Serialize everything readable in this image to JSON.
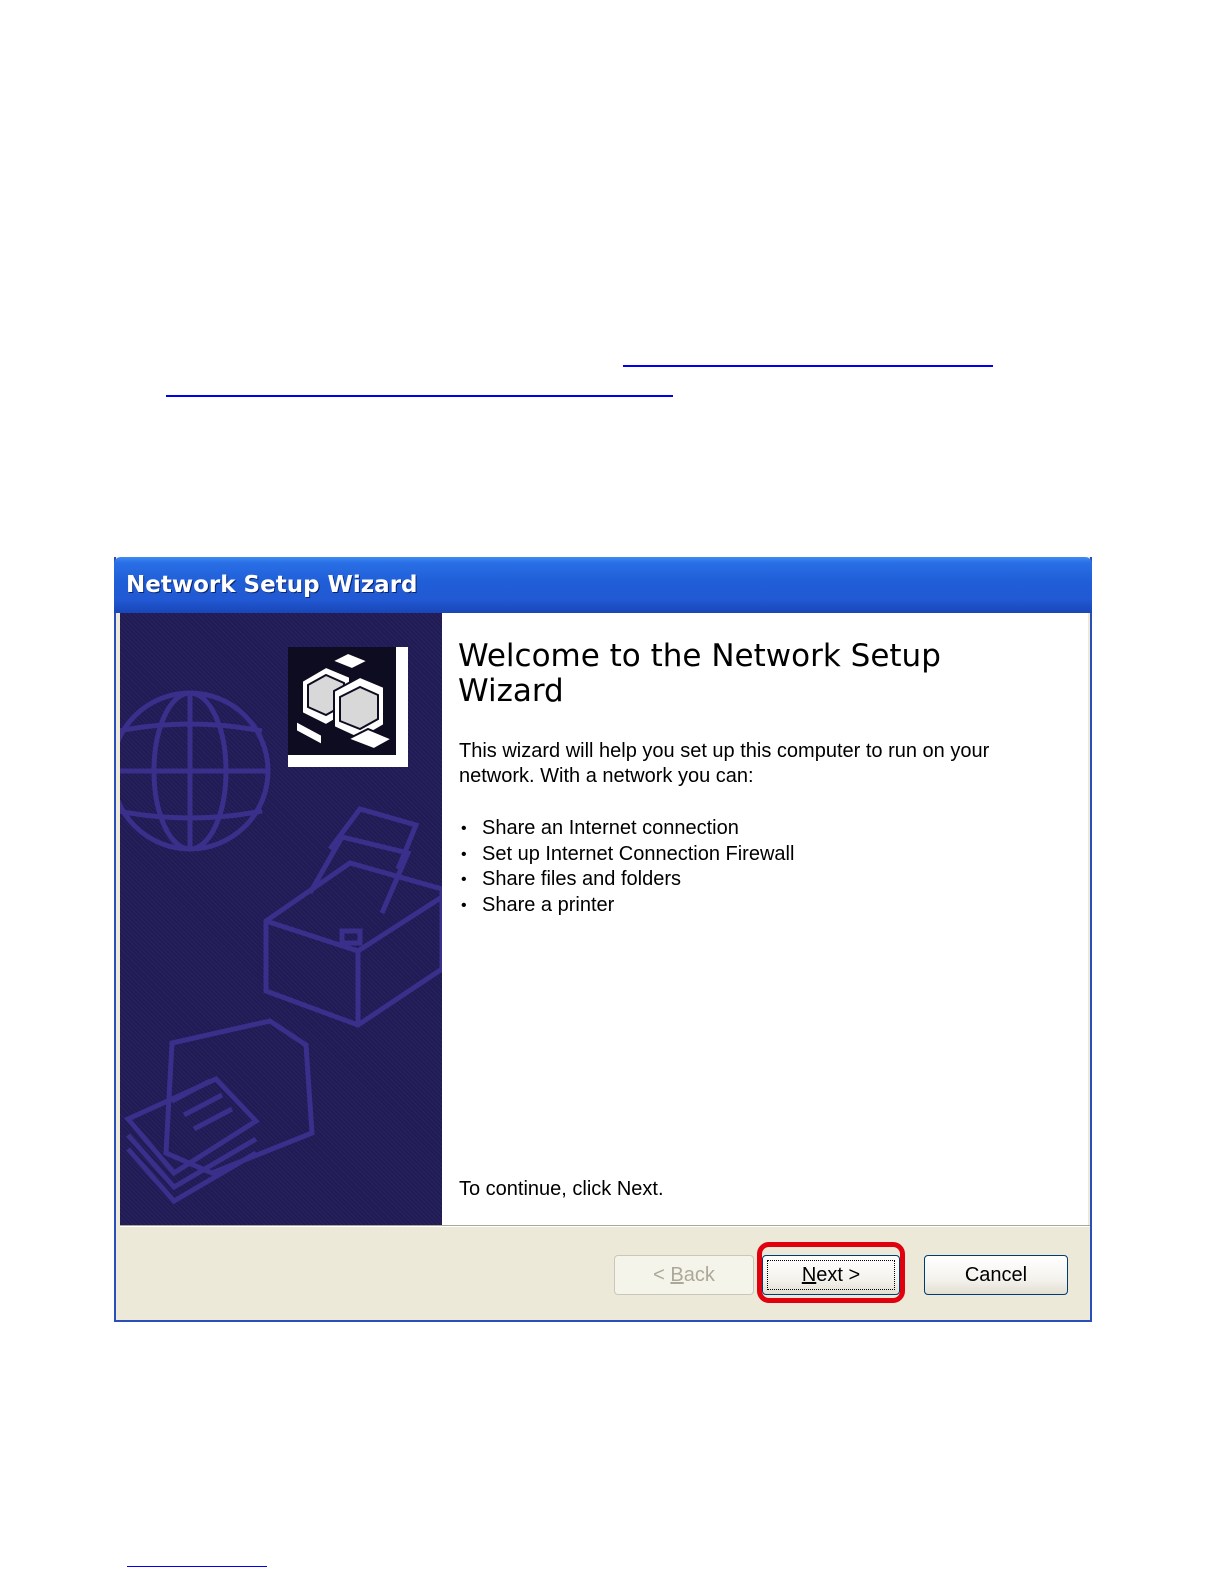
{
  "window": {
    "title": "Network Setup Wizard",
    "heading": "Welcome to the Network Setup Wizard",
    "intro": "This wizard will help you set up this computer to run on your network. With a network you can:",
    "features": [
      "Share an Internet connection",
      "Set up Internet Connection Firewall",
      "Share files and folders",
      "Share a printer"
    ],
    "continue_text": "To continue, click Next."
  },
  "buttons": {
    "back": {
      "lt": "< ",
      "key": "B",
      "rest": "ack"
    },
    "next": {
      "key": "N",
      "rest": "ext >"
    },
    "cancel": "Cancel"
  },
  "colors": {
    "titlebar": "#2259d4",
    "sidebar": "#201a55",
    "highlight": "#e0000e"
  }
}
